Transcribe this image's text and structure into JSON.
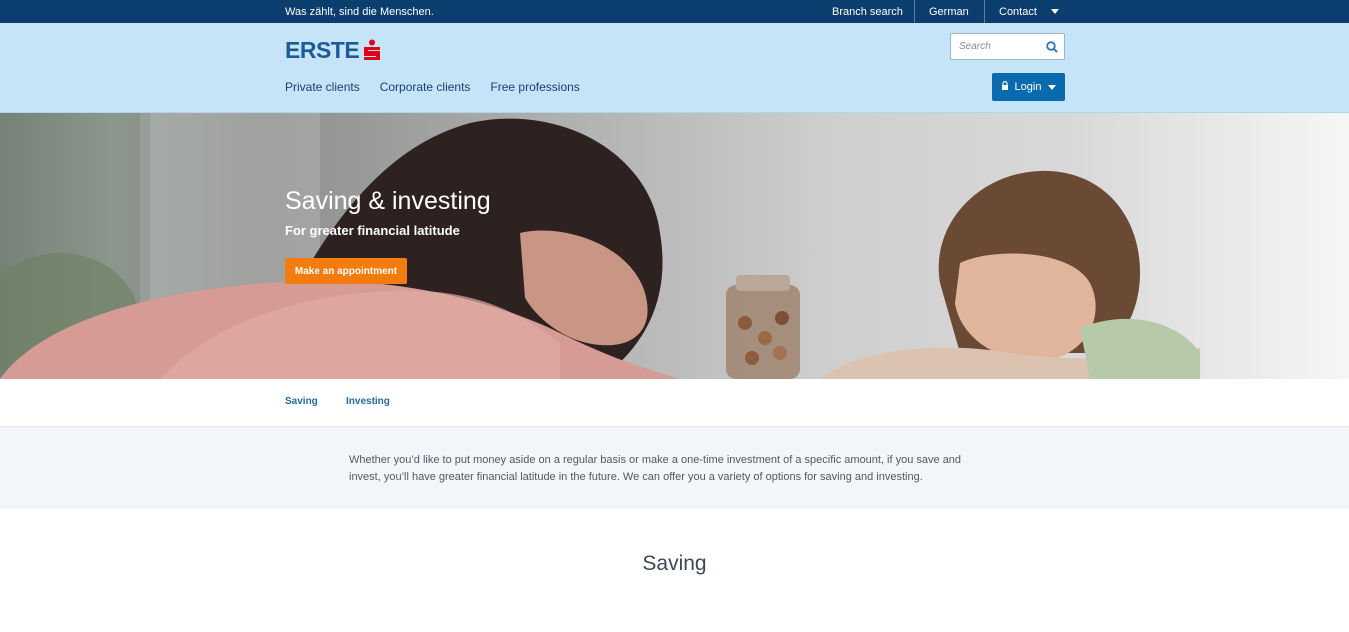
{
  "topbar": {
    "tagline": "Was zählt, sind die Menschen.",
    "links": [
      "Branch search",
      "German",
      "Contact"
    ]
  },
  "header": {
    "logo_text": "ERSTE",
    "search": {
      "placeholder": "Search"
    },
    "nav": [
      "Private clients",
      "Corporate clients",
      "Free professions"
    ],
    "login_label": "Login"
  },
  "hero": {
    "title": "Saving & investing",
    "subtitle": "For greater financial latitude",
    "cta": "Make an appointment"
  },
  "subtabs": [
    "Saving",
    "Investing"
  ],
  "intro": {
    "text": "Whether you’d like to put money aside on a regular basis or make a one-time investment of a specific amount, if you save and invest, you’ll have greater financial latitude in the future. We can offer you a variety of options for saving and investing."
  },
  "section": {
    "title": "Saving"
  },
  "colors": {
    "topbar": "#0b3d6e",
    "header": "#c6e4f8",
    "brand_blue": "#1e5a96",
    "brand_red": "#e2001a",
    "login": "#0a6ab0",
    "cta": "#f47b0d",
    "link": "#1f6aa7"
  },
  "icons": [
    "search-icon",
    "lock-icon",
    "chevron-down-icon",
    "erste-s-icon"
  ]
}
